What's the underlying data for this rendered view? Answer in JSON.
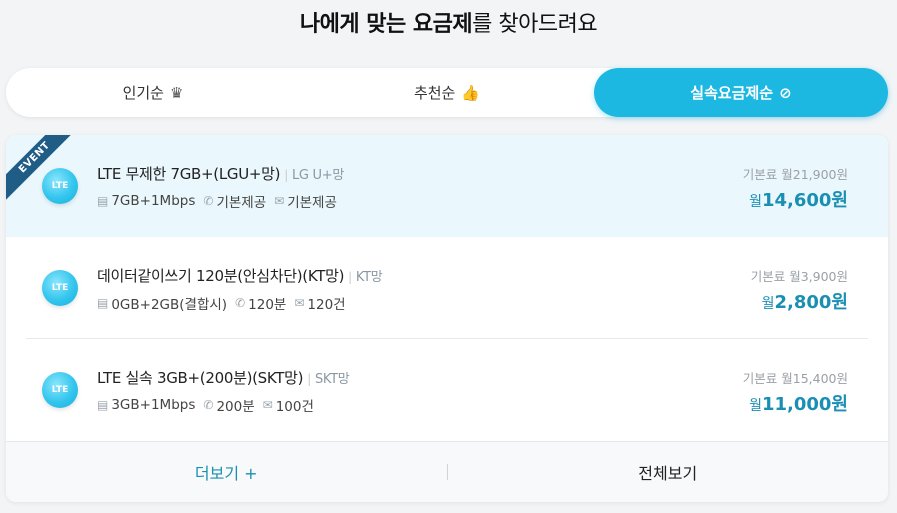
{
  "heading": {
    "strong": "나에게 맞는 요금제",
    "rest": "를 찾아드려요"
  },
  "tabs": [
    {
      "label": "인기순",
      "icon": "crown-icon",
      "glyph": "♛"
    },
    {
      "label": "추천순",
      "icon": "thumbs-up-icon",
      "glyph": "👍"
    },
    {
      "label": "실속요금제순",
      "icon": "coin-icon",
      "glyph": "⊘"
    }
  ],
  "active_tab": 2,
  "plans": [
    {
      "ribbon": "EVENT",
      "badge": "LTE",
      "name": "LTE 무제한 7GB+(LGU+망)",
      "carrier": "LG U+망",
      "data": "7GB+1Mbps",
      "voice": "기본제공",
      "sms": "기본제공",
      "base_price": "기본료 월21,900원",
      "price_prefix": "월",
      "price": "14,600원"
    },
    {
      "badge": "LTE",
      "name": "데이터같이쓰기 120분(안심차단)(KT망)",
      "carrier": "KT망",
      "data": "0GB+2GB(결합시)",
      "voice": "120분",
      "sms": "120건",
      "base_price": "기본료 월3,900원",
      "price_prefix": "월",
      "price": "2,800원"
    },
    {
      "badge": "LTE",
      "name": "LTE 실속 3GB+(200분)(SKT망)",
      "carrier": "SKT망",
      "data": "3GB+1Mbps",
      "voice": "200분",
      "sms": "100건",
      "base_price": "기본료 월15,400원",
      "price_prefix": "월",
      "price": "11,000원"
    }
  ],
  "footer": {
    "more": "더보기 +",
    "all": "전체보기"
  },
  "colors": {
    "accent": "#1db8e2",
    "price": "#1a8fb3",
    "ribbon": "#1f5d86",
    "highlight": "#eaf8fd"
  }
}
